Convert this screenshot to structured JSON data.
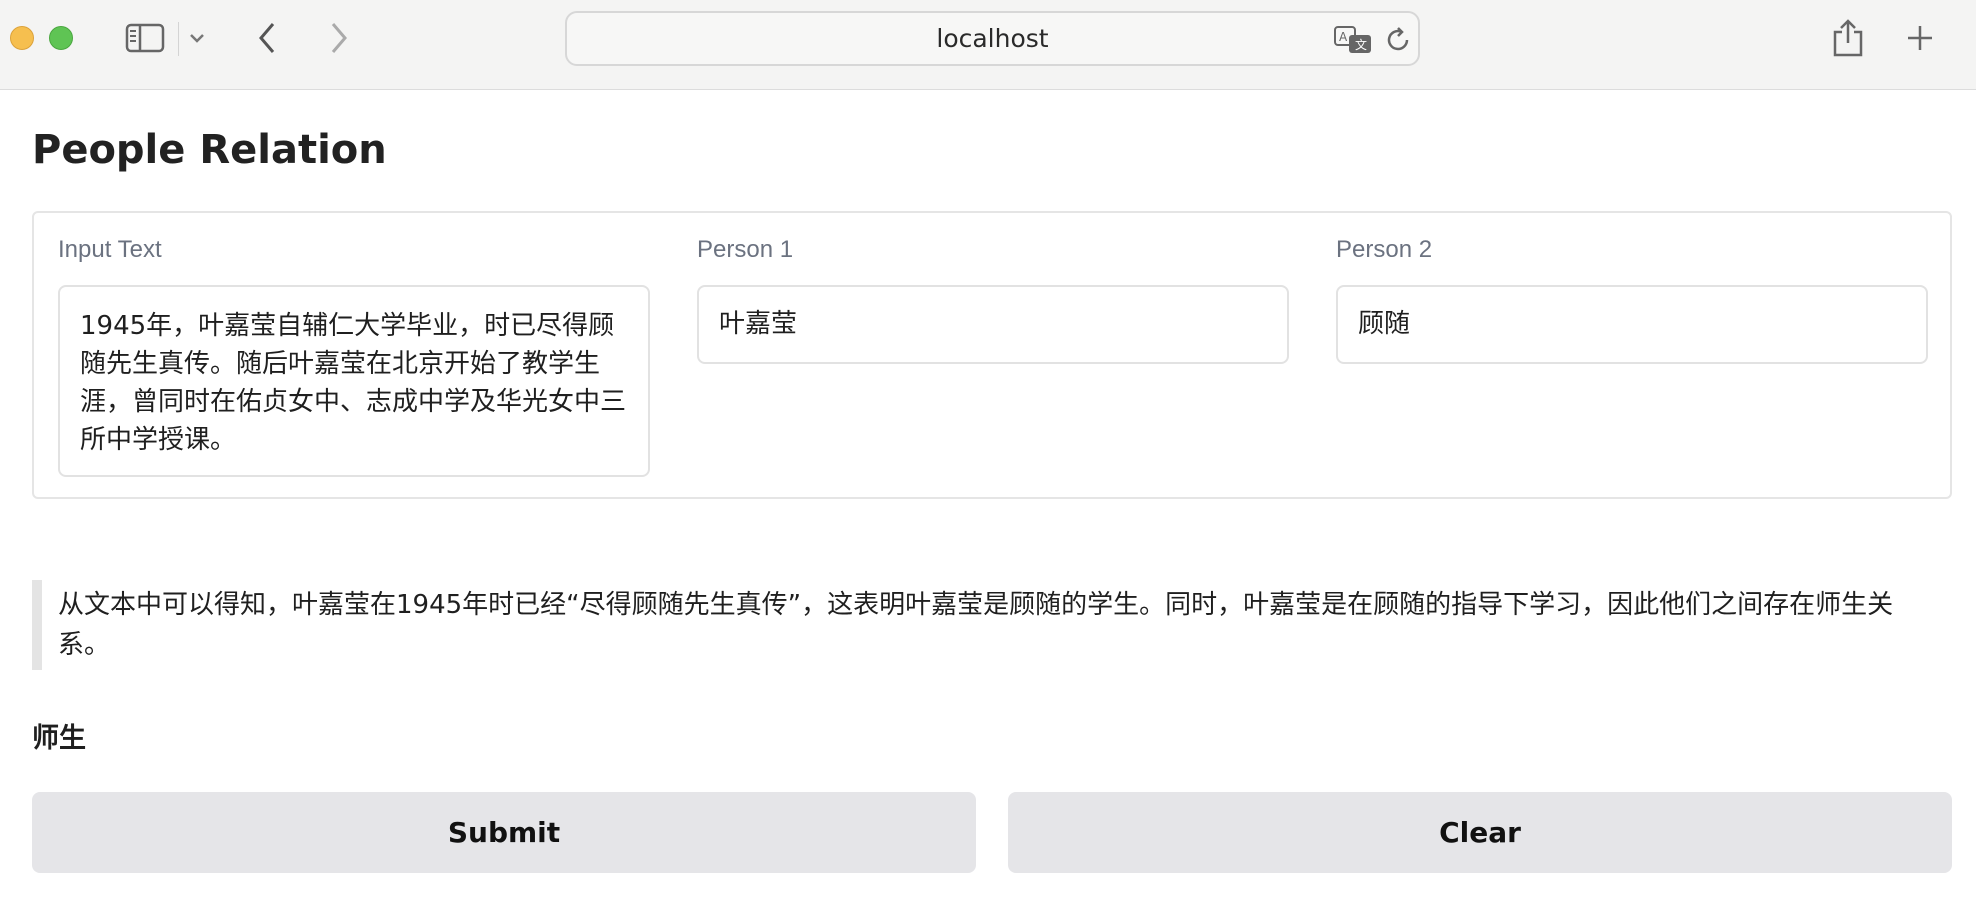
{
  "browser": {
    "url": "localhost"
  },
  "icons": {
    "sidebar": "sidebar-icon",
    "sidebar_menu": "chevron-down-icon",
    "back": "chevron-left-icon",
    "forward": "chevron-right-icon",
    "translate": "translate-icon",
    "reload": "reload-icon",
    "share": "share-icon",
    "new_tab": "plus-icon"
  },
  "colors": {
    "button_bg": "#e5e5e8",
    "label": "#6b7280",
    "border": "#e2e2e2"
  },
  "page": {
    "title": "People Relation"
  },
  "form": {
    "input_text": {
      "label": "Input Text",
      "value": "1945年，叶嘉莹自辅仁大学毕业，时已尽得顾随先生真传。随后叶嘉莹在北京开始了教学生涯，曾同时在佑贞女中、志成中学及华光女中三所中学授课。"
    },
    "person1": {
      "label": "Person 1",
      "value": "叶嘉莹"
    },
    "person2": {
      "label": "Person 2",
      "value": "顾随"
    }
  },
  "output": {
    "explanation": "从文本中可以得知，叶嘉莹在1945年时已经“尽得顾随先生真传”，这表明叶嘉莹是顾随的学生。同时，叶嘉莹是在顾随的指导下学习，因此他们之间存在师生关系。",
    "relation": "师生"
  },
  "actions": {
    "submit_label": "Submit",
    "clear_label": "Clear"
  }
}
